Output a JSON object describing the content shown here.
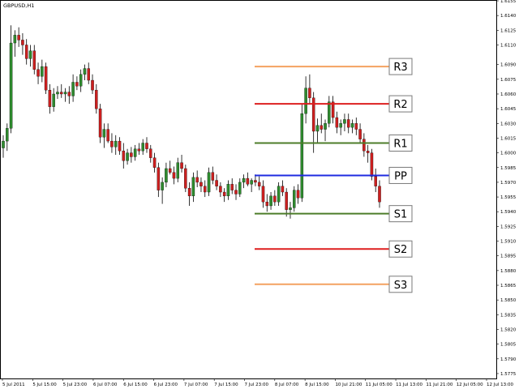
{
  "window": {
    "symbol_label": "GBPUSD,H1"
  },
  "chart_data": {
    "type": "candlestick",
    "symbol": "GBPUSD",
    "timeframe": "H1",
    "colors": {
      "bull_candle": "#2e8b2e",
      "bear_candle": "#cc1f1f",
      "wick": "#000000",
      "frame": "#000000",
      "background": "#ffffff",
      "r3": "#f4a261",
      "r2": "#dd1f1f",
      "r1": "#4d7d2a",
      "pp": "#1f2be0",
      "s1": "#4d7d2a",
      "s2": "#dd1f1f",
      "s3": "#f4a261"
    },
    "y_range": [
      1.577,
      1.6155
    ],
    "y_ticks": [
      "1.6155",
      "1.6140",
      "1.6125",
      "1.6110",
      "1.6090",
      "1.6075",
      "1.6060",
      "1.6045",
      "1.6030",
      "1.6015",
      "1.6000",
      "1.5985",
      "1.5970",
      "1.5955",
      "1.5940",
      "1.5925",
      "1.5910",
      "1.5895",
      "1.5880",
      "1.5865",
      "1.5850",
      "1.5835",
      "1.5820",
      "1.5805",
      "1.5790",
      "1.5775"
    ],
    "x_ticks": [
      "5 Jul 2011",
      "5 Jul 15:00",
      "5 Jul 23:00",
      "6 Jul 07:00",
      "6 Jul 15:00",
      "6 Jul 23:00",
      "7 Jul 07:00",
      "7 Jul 15:00",
      "7 Jul 23:00",
      "8 Jul 07:00",
      "8 Jul 15:00",
      "10 Jul 21:00",
      "11 Jul 05:00",
      "11 Jul 13:00",
      "11 Jul 21:00",
      "12 Jul 05:00",
      "12 Jul 13:00"
    ],
    "pivot_levels": [
      {
        "label": "R3",
        "value": 1.6088
      },
      {
        "label": "R2",
        "value": 1.605
      },
      {
        "label": "R1",
        "value": 1.601
      },
      {
        "label": "PP",
        "value": 1.5977
      },
      {
        "label": "S1",
        "value": 1.5938
      },
      {
        "label": "S2",
        "value": 1.5902
      },
      {
        "label": "S3",
        "value": 1.5866
      }
    ],
    "candles": [
      {
        "o": 1.6005,
        "h": 1.6018,
        "l": 1.5995,
        "c": 1.6012
      },
      {
        "o": 1.6012,
        "h": 1.603,
        "l": 1.6002,
        "c": 1.6025
      },
      {
        "o": 1.6025,
        "h": 1.613,
        "l": 1.602,
        "c": 1.6112
      },
      {
        "o": 1.6112,
        "h": 1.6125,
        "l": 1.6098,
        "c": 1.612
      },
      {
        "o": 1.612,
        "h": 1.6128,
        "l": 1.6108,
        "c": 1.6115
      },
      {
        "o": 1.6115,
        "h": 1.6122,
        "l": 1.61,
        "c": 1.611
      },
      {
        "o": 1.611,
        "h": 1.6116,
        "l": 1.609,
        "c": 1.6096
      },
      {
        "o": 1.6096,
        "h": 1.611,
        "l": 1.6088,
        "c": 1.6104
      },
      {
        "o": 1.6104,
        "h": 1.611,
        "l": 1.608,
        "c": 1.6085
      },
      {
        "o": 1.6085,
        "h": 1.6092,
        "l": 1.607,
        "c": 1.6078
      },
      {
        "o": 1.6078,
        "h": 1.6095,
        "l": 1.6072,
        "c": 1.6088
      },
      {
        "o": 1.6088,
        "h": 1.6092,
        "l": 1.606,
        "c": 1.6064
      },
      {
        "o": 1.6064,
        "h": 1.607,
        "l": 1.604,
        "c": 1.6047
      },
      {
        "o": 1.6047,
        "h": 1.6066,
        "l": 1.6042,
        "c": 1.606
      },
      {
        "o": 1.606,
        "h": 1.6068,
        "l": 1.6055,
        "c": 1.6062
      },
      {
        "o": 1.6062,
        "h": 1.607,
        "l": 1.6056,
        "c": 1.606
      },
      {
        "o": 1.606,
        "h": 1.6066,
        "l": 1.6052,
        "c": 1.6062
      },
      {
        "o": 1.6062,
        "h": 1.6068,
        "l": 1.605,
        "c": 1.6058
      },
      {
        "o": 1.6058,
        "h": 1.608,
        "l": 1.6052,
        "c": 1.6072
      },
      {
        "o": 1.6072,
        "h": 1.6078,
        "l": 1.6064,
        "c": 1.6068
      },
      {
        "o": 1.6068,
        "h": 1.6085,
        "l": 1.6062,
        "c": 1.608
      },
      {
        "o": 1.608,
        "h": 1.609,
        "l": 1.6074,
        "c": 1.6086
      },
      {
        "o": 1.6086,
        "h": 1.6092,
        "l": 1.607,
        "c": 1.6074
      },
      {
        "o": 1.6074,
        "h": 1.608,
        "l": 1.606,
        "c": 1.6064
      },
      {
        "o": 1.6064,
        "h": 1.607,
        "l": 1.604,
        "c": 1.6045
      },
      {
        "o": 1.6045,
        "h": 1.605,
        "l": 1.601,
        "c": 1.6016
      },
      {
        "o": 1.6016,
        "h": 1.603,
        "l": 1.6005,
        "c": 1.6024
      },
      {
        "o": 1.6024,
        "h": 1.603,
        "l": 1.601,
        "c": 1.6012
      },
      {
        "o": 1.6012,
        "h": 1.602,
        "l": 1.6,
        "c": 1.6006
      },
      {
        "o": 1.6006,
        "h": 1.6018,
        "l": 1.5998,
        "c": 1.6012
      },
      {
        "o": 1.6012,
        "h": 1.6016,
        "l": 1.5998,
        "c": 1.6002
      },
      {
        "o": 1.6002,
        "h": 1.601,
        "l": 1.5984,
        "c": 1.5992
      },
      {
        "o": 1.5992,
        "h": 1.6004,
        "l": 1.5988,
        "c": 1.6
      },
      {
        "o": 1.6,
        "h": 1.6006,
        "l": 1.599,
        "c": 1.5996
      },
      {
        "o": 1.5996,
        "h": 1.6008,
        "l": 1.5992,
        "c": 1.6004
      },
      {
        "o": 1.6004,
        "h": 1.601,
        "l": 1.5998,
        "c": 1.6002
      },
      {
        "o": 1.6002,
        "h": 1.6014,
        "l": 1.5998,
        "c": 1.601
      },
      {
        "o": 1.601,
        "h": 1.6016,
        "l": 1.6,
        "c": 1.6004
      },
      {
        "o": 1.6004,
        "h": 1.6008,
        "l": 1.599,
        "c": 1.5995
      },
      {
        "o": 1.5995,
        "h": 1.6,
        "l": 1.598,
        "c": 1.5985
      },
      {
        "o": 1.5985,
        "h": 1.599,
        "l": 1.5955,
        "c": 1.5962
      },
      {
        "o": 1.5962,
        "h": 1.5975,
        "l": 1.5948,
        "c": 1.597
      },
      {
        "o": 1.597,
        "h": 1.599,
        "l": 1.5965,
        "c": 1.5984
      },
      {
        "o": 1.5984,
        "h": 1.5992,
        "l": 1.5978,
        "c": 1.598
      },
      {
        "o": 1.598,
        "h": 1.5986,
        "l": 1.5968,
        "c": 1.5974
      },
      {
        "o": 1.5974,
        "h": 1.5995,
        "l": 1.597,
        "c": 1.599
      },
      {
        "o": 1.599,
        "h": 1.5998,
        "l": 1.598,
        "c": 1.5984
      },
      {
        "o": 1.5984,
        "h": 1.5988,
        "l": 1.596,
        "c": 1.5964
      },
      {
        "o": 1.5964,
        "h": 1.597,
        "l": 1.5946,
        "c": 1.5956
      },
      {
        "o": 1.5956,
        "h": 1.598,
        "l": 1.595,
        "c": 1.5975
      },
      {
        "o": 1.5975,
        "h": 1.5982,
        "l": 1.5965,
        "c": 1.597
      },
      {
        "o": 1.597,
        "h": 1.5975,
        "l": 1.596,
        "c": 1.5966
      },
      {
        "o": 1.5966,
        "h": 1.5972,
        "l": 1.5955,
        "c": 1.596
      },
      {
        "o": 1.596,
        "h": 1.5985,
        "l": 1.5956,
        "c": 1.598
      },
      {
        "o": 1.598,
        "h": 1.5986,
        "l": 1.5968,
        "c": 1.5972
      },
      {
        "o": 1.5972,
        "h": 1.5978,
        "l": 1.5962,
        "c": 1.5966
      },
      {
        "o": 1.5966,
        "h": 1.597,
        "l": 1.5955,
        "c": 1.596
      },
      {
        "o": 1.596,
        "h": 1.5964,
        "l": 1.595,
        "c": 1.5956
      },
      {
        "o": 1.5956,
        "h": 1.5972,
        "l": 1.5952,
        "c": 1.5968
      },
      {
        "o": 1.5968,
        "h": 1.5974,
        "l": 1.5958,
        "c": 1.5962
      },
      {
        "o": 1.5962,
        "h": 1.5968,
        "l": 1.5952,
        "c": 1.5958
      },
      {
        "o": 1.5958,
        "h": 1.5974,
        "l": 1.5955,
        "c": 1.597
      },
      {
        "o": 1.597,
        "h": 1.5978,
        "l": 1.5964,
        "c": 1.5974
      },
      {
        "o": 1.5974,
        "h": 1.598,
        "l": 1.5966,
        "c": 1.5968
      },
      {
        "o": 1.5968,
        "h": 1.5974,
        "l": 1.596,
        "c": 1.5972
      },
      {
        "o": 1.5972,
        "h": 1.5978,
        "l": 1.5966,
        "c": 1.597
      },
      {
        "o": 1.597,
        "h": 1.5976,
        "l": 1.5962,
        "c": 1.5966
      },
      {
        "o": 1.5966,
        "h": 1.5972,
        "l": 1.5944,
        "c": 1.595
      },
      {
        "o": 1.595,
        "h": 1.5958,
        "l": 1.594,
        "c": 1.5946
      },
      {
        "o": 1.5946,
        "h": 1.596,
        "l": 1.5942,
        "c": 1.5956
      },
      {
        "o": 1.5956,
        "h": 1.5962,
        "l": 1.5946,
        "c": 1.595
      },
      {
        "o": 1.595,
        "h": 1.597,
        "l": 1.5946,
        "c": 1.5966
      },
      {
        "o": 1.5966,
        "h": 1.5972,
        "l": 1.5956,
        "c": 1.596
      },
      {
        "o": 1.596,
        "h": 1.5964,
        "l": 1.5935,
        "c": 1.5942
      },
      {
        "o": 1.5942,
        "h": 1.595,
        "l": 1.5933,
        "c": 1.5944
      },
      {
        "o": 1.5944,
        "h": 1.5966,
        "l": 1.594,
        "c": 1.5962
      },
      {
        "o": 1.5962,
        "h": 1.5968,
        "l": 1.5948,
        "c": 1.5954
      },
      {
        "o": 1.5954,
        "h": 1.605,
        "l": 1.595,
        "c": 1.604
      },
      {
        "o": 1.604,
        "h": 1.6078,
        "l": 1.603,
        "c": 1.6066
      },
      {
        "o": 1.6066,
        "h": 1.608,
        "l": 1.605,
        "c": 1.6056
      },
      {
        "o": 1.6056,
        "h": 1.6062,
        "l": 1.6,
        "c": 1.6022
      },
      {
        "o": 1.6022,
        "h": 1.6035,
        "l": 1.601,
        "c": 1.6028
      },
      {
        "o": 1.6028,
        "h": 1.604,
        "l": 1.602,
        "c": 1.6024
      },
      {
        "o": 1.6024,
        "h": 1.6034,
        "l": 1.6012,
        "c": 1.603
      },
      {
        "o": 1.603,
        "h": 1.6058,
        "l": 1.6026,
        "c": 1.6052
      },
      {
        "o": 1.6052,
        "h": 1.6058,
        "l": 1.603,
        "c": 1.6036
      },
      {
        "o": 1.6036,
        "h": 1.6042,
        "l": 1.602,
        "c": 1.6026
      },
      {
        "o": 1.6026,
        "h": 1.6034,
        "l": 1.6018,
        "c": 1.603
      },
      {
        "o": 1.603,
        "h": 1.604,
        "l": 1.6022,
        "c": 1.6034
      },
      {
        "o": 1.6034,
        "h": 1.604,
        "l": 1.602,
        "c": 1.6026
      },
      {
        "o": 1.6026,
        "h": 1.6034,
        "l": 1.602,
        "c": 1.603
      },
      {
        "o": 1.603,
        "h": 1.6036,
        "l": 1.6018,
        "c": 1.6024
      },
      {
        "o": 1.6024,
        "h": 1.603,
        "l": 1.601,
        "c": 1.6014
      },
      {
        "o": 1.6014,
        "h": 1.602,
        "l": 1.5996,
        "c": 1.6002
      },
      {
        "o": 1.6002,
        "h": 1.6008,
        "l": 1.599,
        "c": 1.6
      },
      {
        "o": 1.6,
        "h": 1.6004,
        "l": 1.5972,
        "c": 1.5976
      },
      {
        "o": 1.5976,
        "h": 1.5984,
        "l": 1.596,
        "c": 1.5966
      },
      {
        "o": 1.5966,
        "h": 1.5972,
        "l": 1.5944,
        "c": 1.595
      }
    ]
  }
}
